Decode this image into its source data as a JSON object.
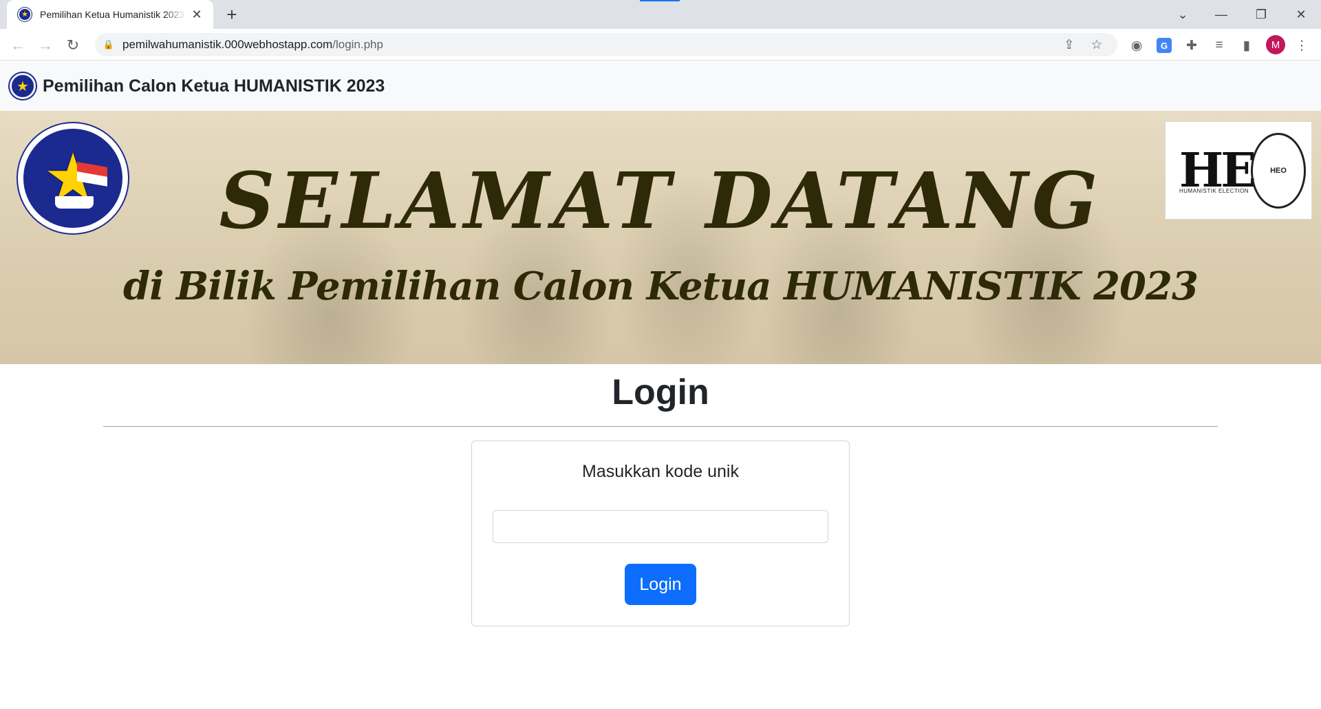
{
  "browser": {
    "tab_title": "Pemilihan Ketua Humanistik 2023",
    "tab_close": "✕",
    "new_tab": "+",
    "url_host": "pemilwahumanistik.000webhostapp.com",
    "url_path": "/login.php",
    "avatar_letter": "M",
    "accent_color": "#1a73e8",
    "icons": {
      "tab_favicon": "★",
      "back": "←",
      "forward": "→",
      "reload": "↻",
      "lock": "🔒",
      "share": "⇪",
      "bookmark": "☆",
      "camera": "◉",
      "translate": "G",
      "extensions": "✚",
      "media": "≡",
      "side_panel": "▮",
      "menu": "⋮",
      "tab_search": "⌄",
      "minimize": "—",
      "restore": "❐",
      "close": "✕"
    }
  },
  "navbar": {
    "brand_text": "Pemilihan Calon Ketua HUMANISTIK 2023",
    "brand_icon": "★"
  },
  "banner": {
    "title": "SELAMAT DATANG",
    "subtitle": "di Bilik Pemilihan Calon Ketua HUMANISTIK 2023",
    "he_logo": "HE",
    "he_seal_text": "HEO",
    "he_caption": "HUMANISTIK ELECTION",
    "emblem_star": "★"
  },
  "login": {
    "page_title": "Login",
    "card_title": "Masukkan kode unik",
    "input_value": "",
    "input_placeholder": "",
    "button_label": "Login",
    "button_color": "#0d6efd"
  }
}
